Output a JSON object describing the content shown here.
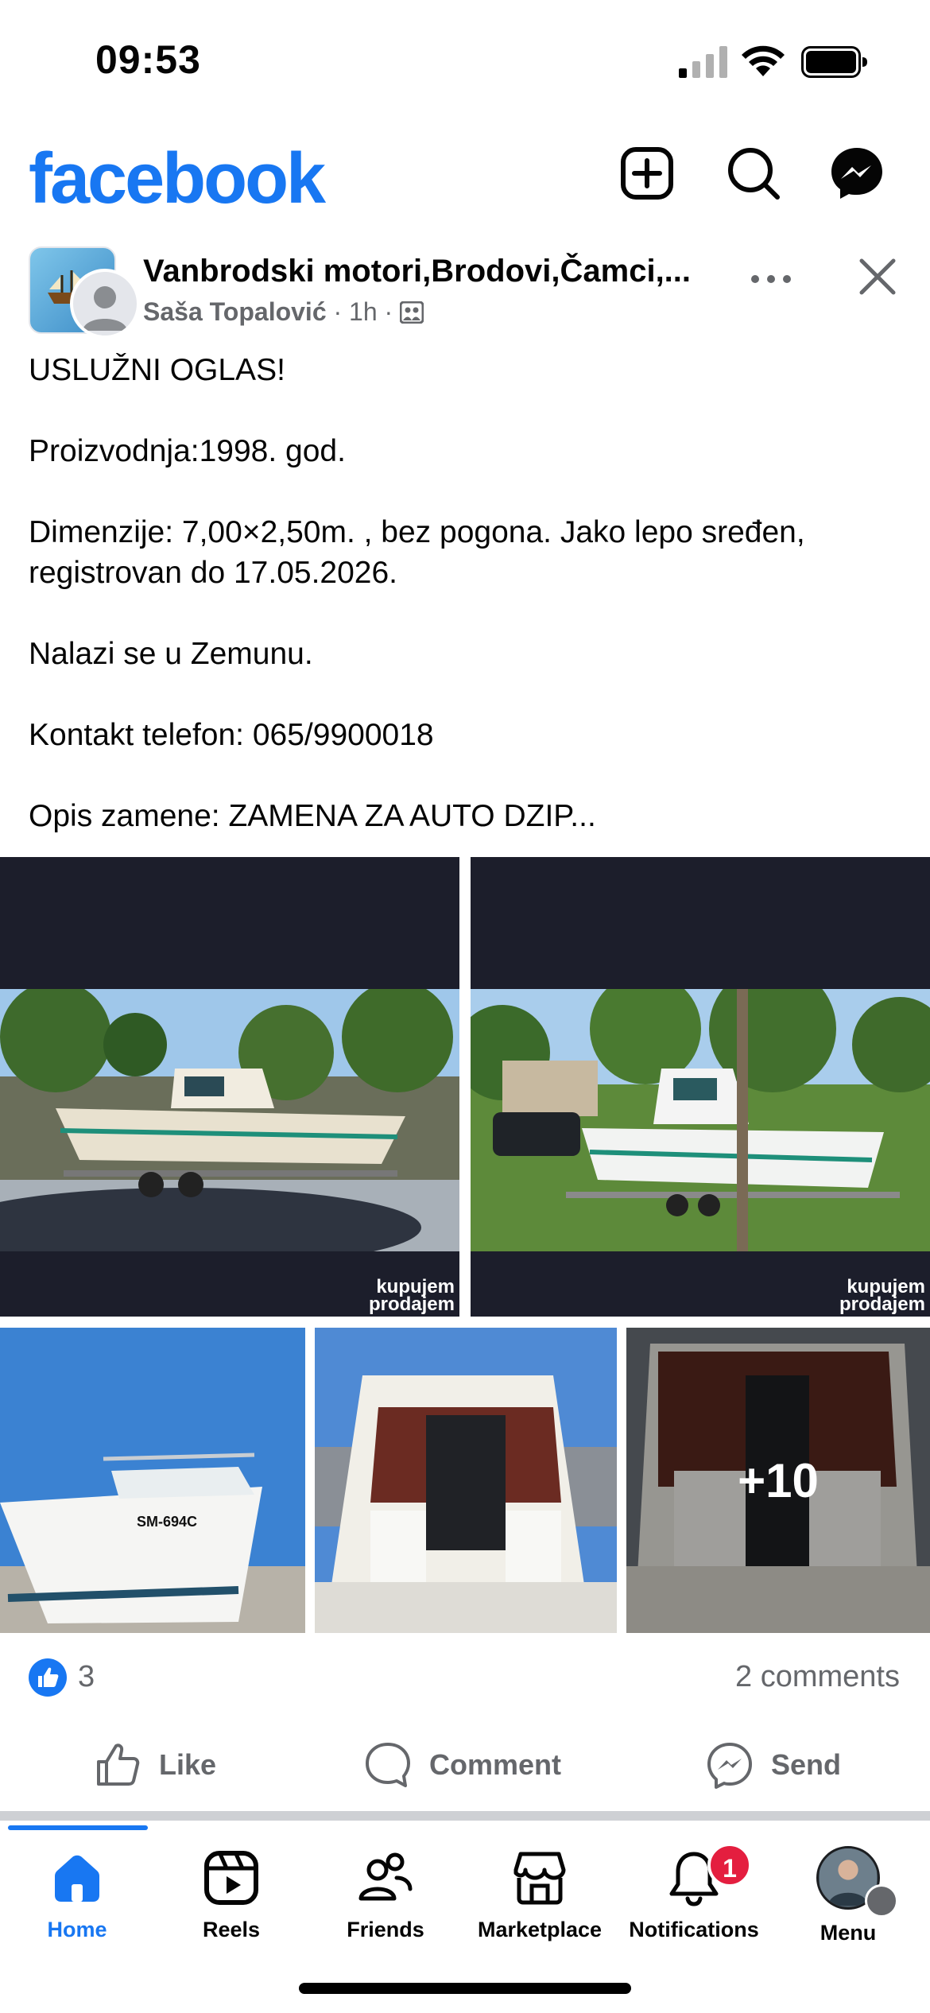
{
  "status_bar": {
    "time": "09:53"
  },
  "header": {
    "logo": "facebook",
    "icons": [
      "add-icon",
      "search-icon",
      "messenger-icon"
    ]
  },
  "post": {
    "group_name": "Vanbrodski motori,Brodovi,Čamci,...",
    "author": "Saša Topalović",
    "time": "1h",
    "text": [
      "USLUŽNI OGLAS!",
      "Proizvodnja:1998. god.",
      "Dimenzije: 7,00×2,50m. , bez pogona. Jako lepo sređen, registrovan do 17.05.2026.",
      "Nalazi se u Zemunu.",
      "Kontakt telefon: 065/9900018",
      "Opis zamene: ZAMENA ZA AUTO DZIP..."
    ],
    "photos": {
      "watermark_line1": "kupujem",
      "watermark_line2": "prodajem",
      "hull_text": "SM-694C",
      "more_count": "+10"
    },
    "reactions_count": "3",
    "comments_count": "2 comments",
    "actions": {
      "like": "Like",
      "comment": "Comment",
      "send": "Send"
    }
  },
  "tabs": [
    {
      "label": "Home",
      "active": true
    },
    {
      "label": "Reels"
    },
    {
      "label": "Friends"
    },
    {
      "label": "Marketplace"
    },
    {
      "label": "Notifications",
      "badge": "1"
    },
    {
      "label": "Menu"
    }
  ],
  "colors": {
    "brand": "#1877f2",
    "badge": "#e41e3f",
    "secondary_text": "#65676b"
  }
}
